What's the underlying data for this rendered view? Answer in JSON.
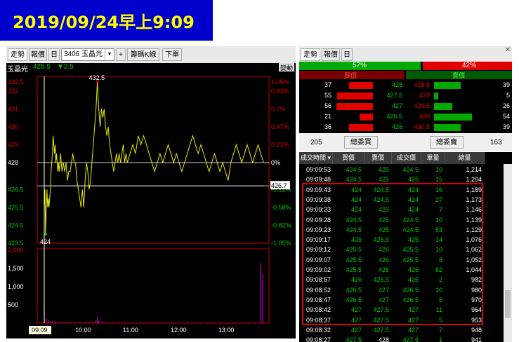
{
  "header": {
    "title": "2019/09/24早上9:09"
  },
  "left_toolbar": {
    "tab_trend": "走勢",
    "tab_quote": "報價",
    "tab_day": "日",
    "stock_select": "3406 玉晶光",
    "plus": "+",
    "chip_kline": "籌碼K線",
    "order": "下單"
  },
  "stock_info": {
    "name": "玉晶光",
    "price": "425.5",
    "change": "▼2.5",
    "mode": "變動"
  },
  "chart_data": {
    "type": "line",
    "title": "",
    "ylim": [
      423.5,
      432.5
    ],
    "price_ticks": [
      "432.5",
      "432",
      "431",
      "430",
      "429",
      "428",
      "426.5",
      "425.5",
      "424.5",
      "423.5"
    ],
    "pct_ticks": [
      "1.05%",
      "0.93%",
      "0.7%",
      "0.47%",
      "0.23%",
      "0%",
      "-0.12%",
      "-0.58%",
      "-0.82%",
      "-1.05%"
    ],
    "reference_price": 428,
    "avg_price_label": "426.7",
    "avg_price": 426.7,
    "high_label": "432.5",
    "low_label": "424",
    "cursor_time": "09:09",
    "x_ticks": [
      "10:00",
      "11:00",
      "12:00",
      "13:00"
    ],
    "volume_ticks": [
      "2,000",
      "1,500",
      "1,000",
      "500"
    ],
    "price_series": [
      {
        "t": 0,
        "v": 425.5
      },
      {
        "t": 1,
        "v": 426.5
      },
      {
        "t": 2,
        "v": 424
      },
      {
        "t": 3,
        "v": 425.5
      },
      {
        "t": 4,
        "v": 426.5
      },
      {
        "t": 5,
        "v": 425.5
      },
      {
        "t": 6,
        "v": 426
      },
      {
        "t": 7,
        "v": 425.5
      },
      {
        "t": 8,
        "v": 426
      },
      {
        "t": 9,
        "v": 426.5
      },
      {
        "t": 10,
        "v": 427.5
      },
      {
        "t": 11,
        "v": 428
      },
      {
        "t": 12,
        "v": 428.5
      },
      {
        "t": 13,
        "v": 429.5
      },
      {
        "t": 14,
        "v": 429
      },
      {
        "t": 15,
        "v": 428.5
      },
      {
        "t": 16,
        "v": 429
      },
      {
        "t": 17,
        "v": 428
      },
      {
        "t": 18,
        "v": 428.5
      },
      {
        "t": 19,
        "v": 428
      },
      {
        "t": 20,
        "v": 427.5
      },
      {
        "t": 21,
        "v": 428
      },
      {
        "t": 22,
        "v": 427.5
      },
      {
        "t": 23,
        "v": 428
      },
      {
        "t": 24,
        "v": 428.5
      },
      {
        "t": 26,
        "v": 427.5
      },
      {
        "t": 28,
        "v": 428
      },
      {
        "t": 30,
        "v": 427.5
      },
      {
        "t": 32,
        "v": 428
      },
      {
        "t": 34,
        "v": 427
      },
      {
        "t": 36,
        "v": 427.5
      },
      {
        "t": 38,
        "v": 427.5
      },
      {
        "t": 40,
        "v": 428
      },
      {
        "t": 42,
        "v": 428.5
      },
      {
        "t": 44,
        "v": 428
      },
      {
        "t": 46,
        "v": 428
      },
      {
        "t": 48,
        "v": 427
      },
      {
        "t": 50,
        "v": 426.5
      },
      {
        "t": 52,
        "v": 426
      },
      {
        "t": 54,
        "v": 425.5
      },
      {
        "t": 56,
        "v": 426.5
      },
      {
        "t": 58,
        "v": 425.5
      },
      {
        "t": 60,
        "v": 427
      },
      {
        "t": 62,
        "v": 428
      },
      {
        "t": 64,
        "v": 427.5
      },
      {
        "t": 66,
        "v": 426.5
      },
      {
        "t": 68,
        "v": 427
      },
      {
        "t": 70,
        "v": 428
      },
      {
        "t": 72,
        "v": 429
      },
      {
        "t": 74,
        "v": 430
      },
      {
        "t": 76,
        "v": 431
      },
      {
        "t": 78,
        "v": 432.5
      },
      {
        "t": 80,
        "v": 431
      },
      {
        "t": 82,
        "v": 430
      },
      {
        "t": 84,
        "v": 431
      },
      {
        "t": 86,
        "v": 430.5
      },
      {
        "t": 88,
        "v": 431
      },
      {
        "t": 90,
        "v": 430
      },
      {
        "t": 92,
        "v": 429.5
      },
      {
        "t": 94,
        "v": 430
      },
      {
        "t": 96,
        "v": 429
      },
      {
        "t": 98,
        "v": 428.5
      },
      {
        "t": 100,
        "v": 428
      },
      {
        "t": 102,
        "v": 427.5
      },
      {
        "t": 104,
        "v": 428
      },
      {
        "t": 106,
        "v": 428.5
      },
      {
        "t": 108,
        "v": 428
      },
      {
        "t": 110,
        "v": 428.5
      },
      {
        "t": 112,
        "v": 428
      },
      {
        "t": 114,
        "v": 428.5
      },
      {
        "t": 116,
        "v": 429
      },
      {
        "t": 118,
        "v": 428
      },
      {
        "t": 120,
        "v": 428.5
      },
      {
        "t": 122,
        "v": 428
      },
      {
        "t": 126,
        "v": 428.5
      },
      {
        "t": 130,
        "v": 429
      },
      {
        "t": 134,
        "v": 428.5
      },
      {
        "t": 138,
        "v": 429.5
      },
      {
        "t": 142,
        "v": 429
      },
      {
        "t": 146,
        "v": 429.5
      },
      {
        "t": 150,
        "v": 429
      },
      {
        "t": 154,
        "v": 428.5
      },
      {
        "t": 158,
        "v": 428
      },
      {
        "t": 162,
        "v": 427.5
      },
      {
        "t": 166,
        "v": 428
      },
      {
        "t": 170,
        "v": 428.5
      },
      {
        "t": 174,
        "v": 428
      },
      {
        "t": 178,
        "v": 428.5
      },
      {
        "t": 182,
        "v": 429
      },
      {
        "t": 186,
        "v": 428.5
      },
      {
        "t": 190,
        "v": 428
      },
      {
        "t": 194,
        "v": 428.5
      },
      {
        "t": 198,
        "v": 428
      },
      {
        "t": 202,
        "v": 427.5
      },
      {
        "t": 206,
        "v": 428
      },
      {
        "t": 210,
        "v": 428.5
      },
      {
        "t": 214,
        "v": 429
      },
      {
        "t": 218,
        "v": 429.5
      },
      {
        "t": 222,
        "v": 429
      },
      {
        "t": 226,
        "v": 428.5
      },
      {
        "t": 230,
        "v": 429
      },
      {
        "t": 234,
        "v": 428.5
      },
      {
        "t": 238,
        "v": 428
      },
      {
        "t": 242,
        "v": 427.5
      },
      {
        "t": 246,
        "v": 428
      },
      {
        "t": 250,
        "v": 428.5
      },
      {
        "t": 254,
        "v": 428
      },
      {
        "t": 258,
        "v": 427.5
      },
      {
        "t": 262,
        "v": 428
      },
      {
        "t": 266,
        "v": 427.5
      },
      {
        "t": 270,
        "v": 427
      },
      {
        "t": 274,
        "v": 428
      },
      {
        "t": 278,
        "v": 428.5
      },
      {
        "t": 282,
        "v": 429
      },
      {
        "t": 286,
        "v": 428.5
      },
      {
        "t": 290,
        "v": 428
      },
      {
        "t": 294,
        "v": 428.5
      },
      {
        "t": 298,
        "v": 429
      },
      {
        "t": 302,
        "v": 428.5
      },
      {
        "t": 306,
        "v": 428
      },
      {
        "t": 310,
        "v": 428.5
      },
      {
        "t": 314,
        "v": 429
      },
      {
        "t": 318,
        "v": 428.5
      },
      {
        "t": 322,
        "v": 428
      }
    ],
    "volume_series": [
      {
        "t": 0,
        "v": 350
      },
      {
        "t": 3,
        "v": 120
      },
      {
        "t": 6,
        "v": 80
      },
      {
        "t": 9,
        "v": 60
      },
      {
        "t": 12,
        "v": 50
      },
      {
        "t": 16,
        "v": 40
      },
      {
        "t": 20,
        "v": 30
      },
      {
        "t": 25,
        "v": 35
      },
      {
        "t": 30,
        "v": 25
      },
      {
        "t": 35,
        "v": 30
      },
      {
        "t": 40,
        "v": 20
      },
      {
        "t": 45,
        "v": 25
      },
      {
        "t": 50,
        "v": 30
      },
      {
        "t": 55,
        "v": 20
      },
      {
        "t": 60,
        "v": 25
      },
      {
        "t": 66,
        "v": 20
      },
      {
        "t": 72,
        "v": 40
      },
      {
        "t": 76,
        "v": 80
      },
      {
        "t": 78,
        "v": 150
      },
      {
        "t": 80,
        "v": 60
      },
      {
        "t": 85,
        "v": 30
      },
      {
        "t": 90,
        "v": 40
      },
      {
        "t": 100,
        "v": 20
      },
      {
        "t": 110,
        "v": 25
      },
      {
        "t": 120,
        "v": 20
      },
      {
        "t": 130,
        "v": 15
      },
      {
        "t": 140,
        "v": 20
      },
      {
        "t": 150,
        "v": 25
      },
      {
        "t": 160,
        "v": 15
      },
      {
        "t": 170,
        "v": 20
      },
      {
        "t": 180,
        "v": 25
      },
      {
        "t": 190,
        "v": 20
      },
      {
        "t": 200,
        "v": 15
      },
      {
        "t": 210,
        "v": 30
      },
      {
        "t": 220,
        "v": 20
      },
      {
        "t": 230,
        "v": 15
      },
      {
        "t": 240,
        "v": 20
      },
      {
        "t": 250,
        "v": 25
      },
      {
        "t": 260,
        "v": 20
      },
      {
        "t": 270,
        "v": 25
      },
      {
        "t": 280,
        "v": 20
      },
      {
        "t": 290,
        "v": 15
      },
      {
        "t": 300,
        "v": 20
      },
      {
        "t": 310,
        "v": 25
      },
      {
        "t": 318,
        "v": 1650
      },
      {
        "t": 321,
        "v": 1350
      }
    ]
  },
  "right_toolbar": {
    "tab_trend": "走勢",
    "tab_quote": "報價",
    "tab_day": "日"
  },
  "ratio": {
    "buy_pct": "57%",
    "sell_pct": "42%",
    "buy_fraction": 0.57,
    "sell_fraction": 0.42,
    "buy_label": "買價",
    "sell_label": "賣價"
  },
  "order_book": [
    {
      "bid_vol": "37",
      "bid_bar": 0.45,
      "bid": "428",
      "ask": "428.5",
      "ask_bar": 0.48,
      "ask_vol": "39"
    },
    {
      "bid_vol": "55",
      "bid_bar": 0.68,
      "bid": "427.5",
      "ask": "429",
      "ask_bar": 0.07,
      "ask_vol": "5"
    },
    {
      "bid_vol": "56",
      "bid_bar": 0.7,
      "bid": "427",
      "ask": "429.5",
      "ask_bar": 0.32,
      "ask_vol": "26"
    },
    {
      "bid_vol": "21",
      "bid_bar": 0.26,
      "bid": "426.5",
      "ask": "430",
      "ask_bar": 0.68,
      "ask_vol": "54"
    },
    {
      "bid_vol": "36",
      "bid_bar": 0.45,
      "bid": "426",
      "ask": "430.5",
      "ask_bar": 0.48,
      "ask_vol": "39"
    }
  ],
  "totals": {
    "bid_total": "205",
    "bid_label": "總委買",
    "ask_label": "總委賣",
    "ask_total": "163"
  },
  "trades": {
    "headers": [
      "成交時間 ▾",
      "買價",
      "賣價",
      "成交價",
      "單量",
      "總量"
    ],
    "rows": [
      [
        "09:09:53",
        "424.5",
        "425",
        "424.5",
        "10",
        "1,214"
      ],
      [
        "09:09:48",
        "424.5",
        "425",
        "425",
        "15",
        "1,204"
      ],
      [
        "09:09:43",
        "424",
        "424.5",
        "424",
        "16",
        "1,189"
      ],
      [
        "09:09:38",
        "424",
        "424.5",
        "424",
        "27",
        "1,173"
      ],
      [
        "09:09:33",
        "424",
        "425",
        "424",
        "7",
        "1,146"
      ],
      [
        "09:09:28",
        "424.5",
        "425",
        "424.5",
        "10",
        "1,139"
      ],
      [
        "09:09:23",
        "424.5",
        "425",
        "424.5",
        "53",
        "1,129"
      ],
      [
        "09:09:17",
        "425",
        "425.5",
        "425",
        "14",
        "1,076"
      ],
      [
        "09:09:12",
        "425.5",
        "426",
        "425.5",
        "10",
        "1,062"
      ],
      [
        "09:09:07",
        "425.5",
        "426",
        "425.5",
        "8",
        "1,052"
      ],
      [
        "09:09:02",
        "425.5",
        "426",
        "426",
        "62",
        "1,044"
      ],
      [
        "09:08:57",
        "426",
        "426.5",
        "426",
        "2",
        "982"
      ],
      [
        "09:08:52",
        "426.5",
        "427",
        "426.5",
        "10",
        "980"
      ],
      [
        "09:08:47",
        "426.5",
        "427",
        "426.5",
        "6",
        "970"
      ],
      [
        "09:08:42",
        "427",
        "427.5",
        "427",
        "11",
        "964"
      ],
      [
        "09:08:37",
        "427",
        "427.5",
        "427",
        "5",
        "953"
      ],
      [
        "09:08:32",
        "427",
        "427.5",
        "427",
        "7",
        "948"
      ],
      [
        "09:08:27",
        "427.5",
        "428",
        "427.5",
        "1",
        "941"
      ]
    ]
  },
  "colors": {
    "up": "#e00000",
    "down": "#00c800",
    "price_line": "#e8e800",
    "volume": "#c000c0",
    "highlight": "#e00000"
  }
}
